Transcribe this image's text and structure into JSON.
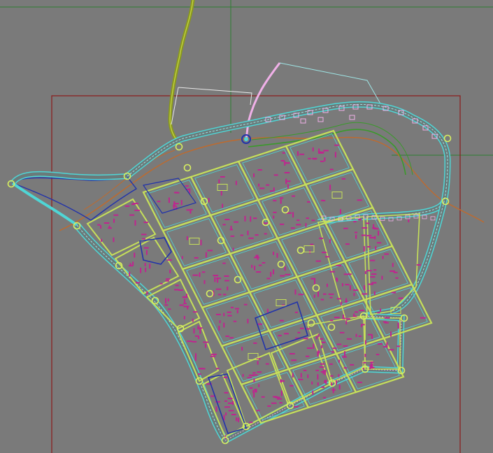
{
  "canvas": {
    "background": "#7a7a7a",
    "crosshair_color": "#2e7d32",
    "frame_color": "#8b1a1a"
  },
  "layers": {
    "road_outline": "#4fd6d6",
    "road_edge": "#9ee6e6",
    "plot_boundary": "#c6e05a",
    "buildings": "#c0248f",
    "district_blue": "#2233aa",
    "river_orange": "#c06a2c",
    "contour_green": "#3a9a2a",
    "highway_olive": "#8a9a1a",
    "path_pink": "#f0b0e8",
    "path_white": "#e8e8e8",
    "node_ring": "#d8f060"
  }
}
